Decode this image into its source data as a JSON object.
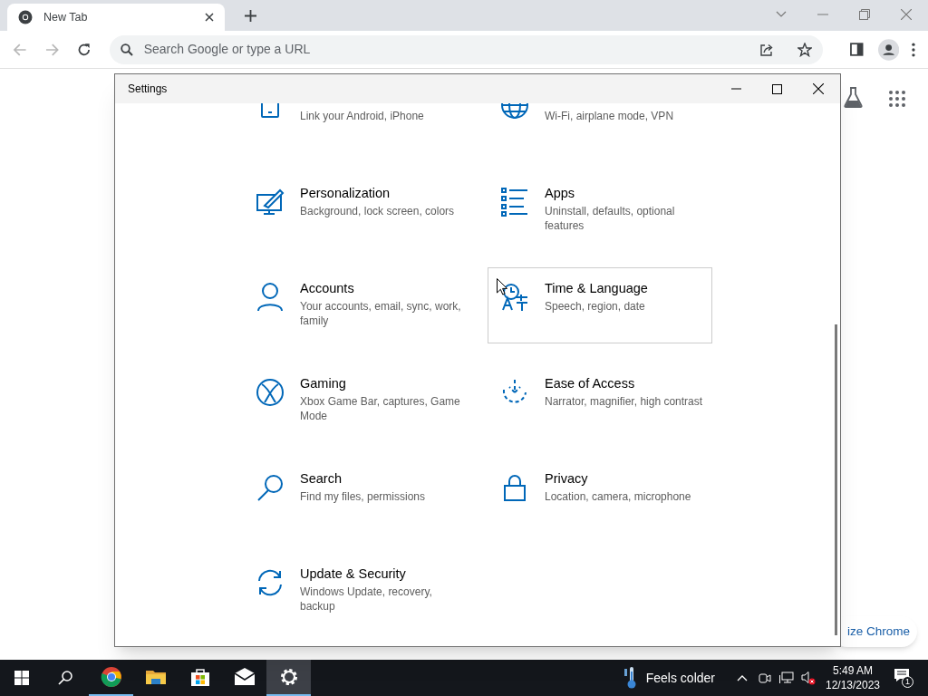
{
  "browser": {
    "tab": {
      "title": "New Tab",
      "selected": true
    },
    "address_placeholder": "Search Google or type a URL",
    "customize_button": "ize Chrome"
  },
  "settings_window": {
    "title": "Settings",
    "tiles": [
      {
        "kind": "phone",
        "description": "Link your Android, iPhone",
        "hovered": false
      },
      {
        "kind": "network",
        "description": "Wi-Fi, airplane mode, VPN",
        "hovered": false
      },
      {
        "kind": "personalization",
        "title": "Personalization",
        "description": "Background, lock screen, colors",
        "hovered": false
      },
      {
        "kind": "apps",
        "title": "Apps",
        "description": "Uninstall, defaults, optional features",
        "hovered": false
      },
      {
        "kind": "accounts",
        "title": "Accounts",
        "description": "Your accounts, email, sync, work, family",
        "hovered": false
      },
      {
        "kind": "time",
        "title": "Time & Language",
        "description": "Speech, region, date",
        "hovered": true
      },
      {
        "kind": "gaming",
        "title": "Gaming",
        "description": "Xbox Game Bar, captures, Game Mode",
        "hovered": false
      },
      {
        "kind": "ease",
        "title": "Ease of Access",
        "description": "Narrator, magnifier, high contrast",
        "hovered": false
      },
      {
        "kind": "search",
        "title": "Search",
        "description": "Find my files, permissions",
        "hovered": false
      },
      {
        "kind": "privacy",
        "title": "Privacy",
        "description": "Location, camera, microphone",
        "hovered": false
      },
      {
        "kind": "update",
        "title": "Update & Security",
        "description": "Windows Update, recovery, backup",
        "hovered": false
      }
    ]
  },
  "taskbar": {
    "apps": [
      {
        "kind": "chrome",
        "running": true,
        "selected": false
      },
      {
        "kind": "explorer",
        "running": false,
        "selected": false
      },
      {
        "kind": "store",
        "running": false,
        "selected": false
      },
      {
        "kind": "mail",
        "running": false,
        "selected": false
      },
      {
        "kind": "settings",
        "running": true,
        "selected": true
      }
    ],
    "weather": "Feels colder",
    "time": "5:49 AM",
    "date": "12/13/2023",
    "notifications": "1"
  }
}
